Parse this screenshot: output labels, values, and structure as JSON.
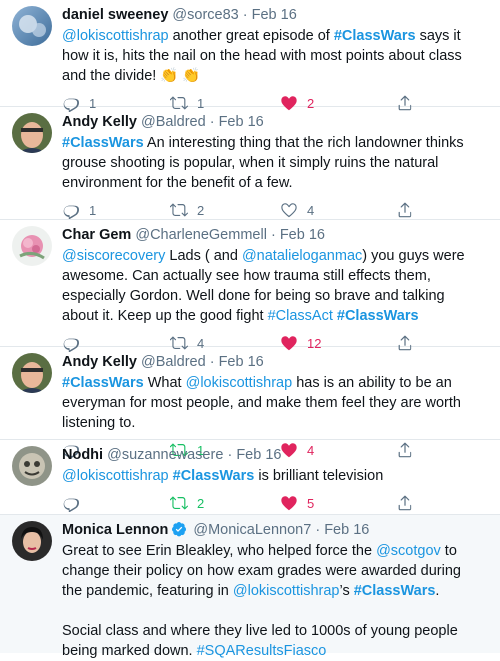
{
  "tweets": [
    {
      "name": "daniel sweeney",
      "handle": "@sorce83",
      "date": "Feb 16",
      "body": [
        {
          "t": "m",
          "v": "@lokiscottishrap"
        },
        {
          "t": "p",
          "v": " another great episode of "
        },
        {
          "t": "h",
          "v": "#ClassWars"
        },
        {
          "t": "p",
          "v": " says it how it is, hits the nail on the head with most points about class and the divide! 👏 👏"
        }
      ],
      "reply": "1",
      "retweet": "1",
      "like": "2",
      "retweeted": false,
      "liked": true
    },
    {
      "name": "Andy Kelly",
      "handle": "@Baldred",
      "date": "Feb 16",
      "body": [
        {
          "t": "h",
          "v": "#ClassWars"
        },
        {
          "t": "p",
          "v": " An interesting thing that the rich landowner thinks grouse shooting is popular, when it simply ruins the natural environment for the benefit of a few."
        }
      ],
      "reply": "1",
      "retweet": "2",
      "like": "4",
      "retweeted": false,
      "liked": false
    },
    {
      "name": "Char Gem",
      "handle": "@CharleneGemmell",
      "date": "Feb 16",
      "body": [
        {
          "t": "m",
          "v": "@siscorecovery"
        },
        {
          "t": "p",
          "v": " Lads ( and "
        },
        {
          "t": "m",
          "v": "@natalieloganmac"
        },
        {
          "t": "p",
          "v": ") you guys were awesome. Can actually see how trauma still effects them, especially Gordon. Well done for being so brave and talking about it. Keep up the good fight "
        },
        {
          "t": "m",
          "v": "#ClassAct"
        },
        {
          "t": "p",
          "v": " "
        },
        {
          "t": "h",
          "v": "#ClassWars"
        }
      ],
      "reply": "",
      "retweet": "4",
      "like": "12",
      "retweeted": false,
      "liked": true
    },
    {
      "name": "Andy Kelly",
      "handle": "@Baldred",
      "date": "Feb 16",
      "body": [
        {
          "t": "h",
          "v": "#ClassWars"
        },
        {
          "t": "p",
          "v": " What "
        },
        {
          "t": "m",
          "v": "@lokiscottishrap"
        },
        {
          "t": "p",
          "v": " has is an ability to be an everyman for most people, and make them feel they are worth listening to."
        }
      ],
      "reply": "",
      "retweet": "1",
      "like": "4",
      "retweeted": true,
      "liked": true
    },
    {
      "name": "Nodhi",
      "handle": "@suzannewasere",
      "date": "Feb 16",
      "body": [
        {
          "t": "m",
          "v": "@lokiscottishrap"
        },
        {
          "t": "p",
          "v": " "
        },
        {
          "t": "h",
          "v": "#ClassWars"
        },
        {
          "t": "p",
          "v": " is brilliant television"
        }
      ],
      "reply": "",
      "retweet": "2",
      "like": "5",
      "retweeted": true,
      "liked": true
    },
    {
      "name": "Monica Lennon",
      "handle": "@MonicaLennon7",
      "date": "Feb 16",
      "verified": true,
      "body": [
        {
          "t": "p",
          "v": "Great to see Erin Bleakley, who helped force the "
        },
        {
          "t": "m",
          "v": "@scotgov"
        },
        {
          "t": "p",
          "v": " to change their policy on how exam grades were awarded during the pandemic, featuring in "
        },
        {
          "t": "m",
          "v": "@lokiscottishrap"
        },
        {
          "t": "p",
          "v": "’s "
        },
        {
          "t": "h",
          "v": "#ClassWars"
        },
        {
          "t": "p",
          "v": "."
        },
        {
          "t": "br",
          "v": ""
        },
        {
          "t": "p",
          "v": "Social class and where they live led to 1000s of young people being marked down. "
        },
        {
          "t": "m",
          "v": "#SQAResultsFiasco"
        }
      ],
      "reply": "",
      "retweet": "",
      "like": "",
      "retweeted": false,
      "liked": false
    }
  ],
  "icons": {
    "reply": "reply-icon",
    "retweet": "retweet-icon",
    "like": "heart-icon",
    "share": "share-icon",
    "verified": "verified-badge-icon"
  },
  "colors": {
    "link": "#1b95e0",
    "muted": "#5b7083",
    "retweet_active": "#17bf63",
    "like_active": "#e0245e"
  }
}
